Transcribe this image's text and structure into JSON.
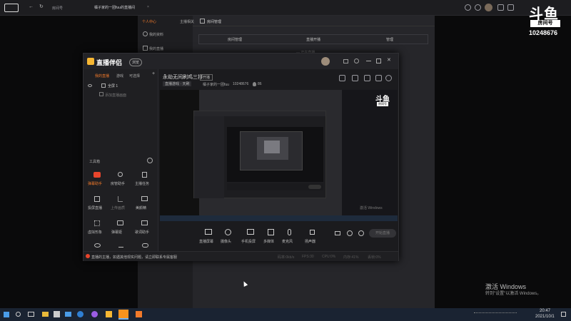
{
  "browser": {
    "address": "房间号",
    "tab_title": "橘子家的一团fuu的直播间",
    "tab_close": "×"
  },
  "douyu_logo": {
    "brand_text": "斗鱼",
    "badge_label": "房间号",
    "room_number": "10248676"
  },
  "center_panel": {
    "side_items": [
      "个人中心",
      "我的资料",
      "我的直播"
    ],
    "top_tab": "主播相关",
    "header_label": "房间管理",
    "tabs": [
      "房间管理",
      "直播开播",
      "管理"
    ],
    "notice": "— 正在直播..."
  },
  "assistant": {
    "title": "直播伴侣",
    "badge": "浏览",
    "tabs": [
      "我的直播",
      "游戏",
      "可选择"
    ],
    "scene": "全屏 1",
    "scene_item": "添加直播画面",
    "tools_label": "工具箱",
    "tools": [
      {
        "label": "弹幕助手",
        "icon": "gift-icon"
      },
      {
        "label": "房管助手",
        "icon": "user-icon"
      },
      {
        "label": "主播任务",
        "icon": "cup-icon"
      },
      {
        "label": "投屏直播",
        "icon": "box-icon"
      },
      {
        "label": "上传画质",
        "icon": "upload-icon"
      },
      {
        "label": "美颜精",
        "icon": "monitor-icon"
      },
      {
        "label": "虚拟形象",
        "icon": "grid-icon"
      },
      {
        "label": "弹幕姬",
        "icon": "bag-icon"
      },
      {
        "label": "歌词助手",
        "icon": "screen-icon"
      },
      {
        "label": "",
        "icon": "eye-icon"
      },
      {
        "label": "",
        "icon": "download-icon"
      },
      {
        "label": "",
        "icon": "gamepad-icon"
      }
    ],
    "footer_tip": "直播的主播，如遇其他现实问题，请立即联系专属客服",
    "room_title": "永劫无间刷鸡三排",
    "room_badge": "开播",
    "category": "直播游戏 · 天刷",
    "streamer_name": "橘子家的一团fuu",
    "room_id": "10248676",
    "hot_count": "86",
    "bottom_tools": [
      "直播屏幕",
      "摄像头",
      "手机投屏",
      "多媒体",
      "麦克风",
      "扬声器"
    ],
    "start_button": "开始直播",
    "stats": [
      "码率:0kb/s",
      "FPS:30",
      "CPU:0%",
      "内存:41%",
      "丢帧:0%"
    ]
  },
  "nested_screen": {
    "logo": "斗鱼",
    "logo_badge": "房间号",
    "watermark": "激活 Windows"
  },
  "windows_overlay": {
    "title": "激活 Windows",
    "subtitle": "转到\"设置\"以激活 Windows。"
  },
  "taskbar": {
    "time": "20:47",
    "date": "2021/10/1"
  }
}
